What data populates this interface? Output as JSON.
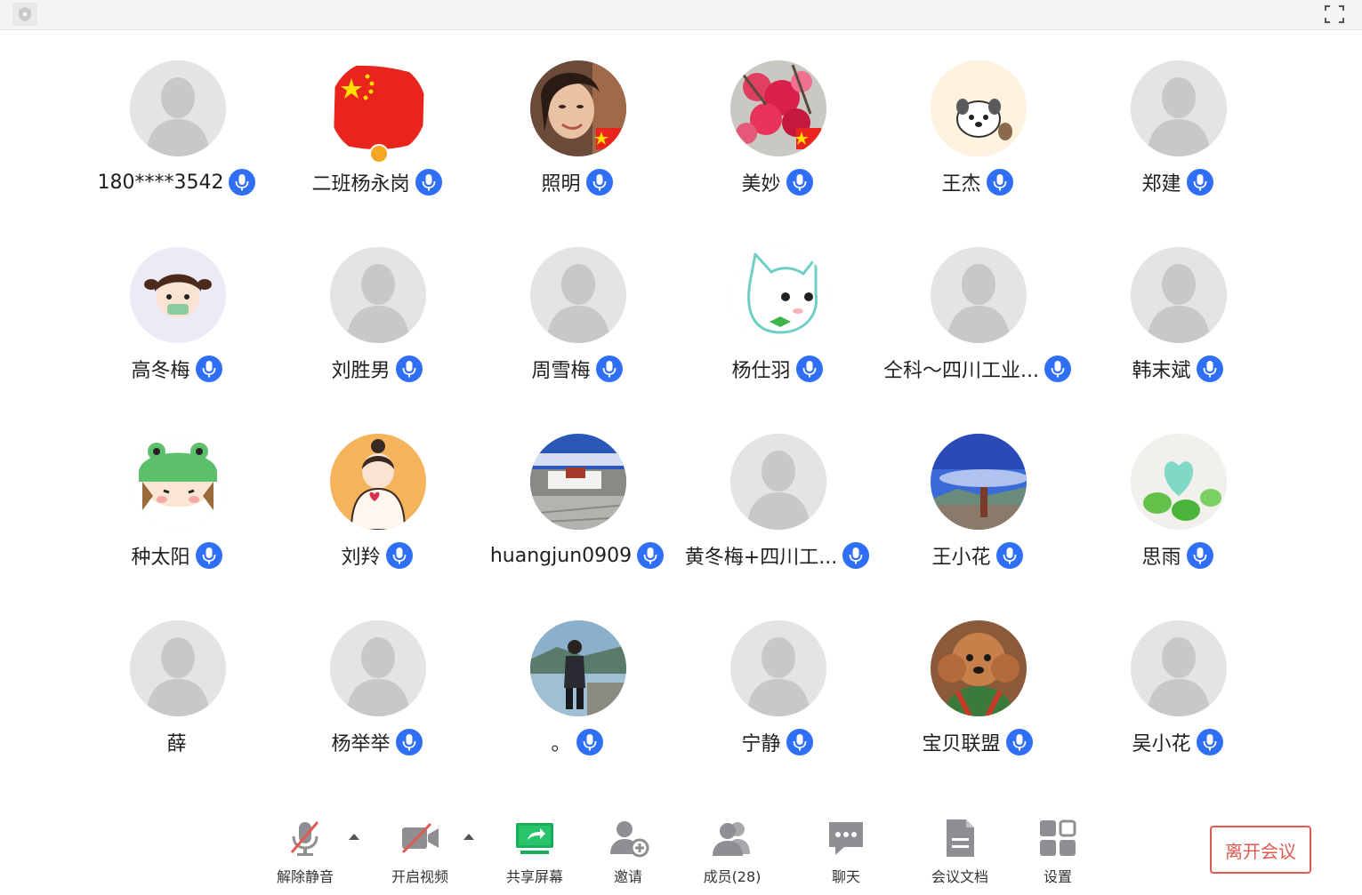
{
  "colors": {
    "mic_blue": "#2f6ff5",
    "leave_red": "#e05a52",
    "share_green": "#1aad5a",
    "placeholder_gray": "#e3e3e3"
  },
  "participants": [
    {
      "name": "180****3542",
      "avatar": "default-avatar"
    },
    {
      "name": "二班杨永岗",
      "avatar": "china-flag-avatar",
      "host_badge": true
    },
    {
      "name": "照明",
      "avatar": "woman-photo-avatar"
    },
    {
      "name": "美妙",
      "avatar": "flower-photo-avatar"
    },
    {
      "name": "王杰",
      "avatar": "cartoon-dog-avatar"
    },
    {
      "name": "郑建",
      "avatar": "default-avatar"
    },
    {
      "name": "高冬梅",
      "avatar": "cartoon-girl-avatar"
    },
    {
      "name": "刘胜男",
      "avatar": "default-avatar"
    },
    {
      "name": "周雪梅",
      "avatar": "default-avatar"
    },
    {
      "name": "杨仕羽",
      "avatar": "cartoon-cat-avatar"
    },
    {
      "name": "仝科～四川工业...",
      "avatar": "default-avatar"
    },
    {
      "name": "韩末斌",
      "avatar": "default-avatar"
    },
    {
      "name": "种太阳",
      "avatar": "cartoon-frog-girl-avatar"
    },
    {
      "name": "刘羚",
      "avatar": "cartoon-woman-avatar"
    },
    {
      "name": "huangjun0909",
      "avatar": "palace-photo-avatar"
    },
    {
      "name": "黄冬梅+四川工...",
      "avatar": "default-avatar"
    },
    {
      "name": "王小花",
      "avatar": "sky-photo-avatar"
    },
    {
      "name": "思雨",
      "avatar": "heart-photo-avatar"
    },
    {
      "name": "薛",
      "avatar": "default-avatar",
      "no_mic": true
    },
    {
      "name": "杨举举",
      "avatar": "default-avatar"
    },
    {
      "name": "。",
      "avatar": "lake-photo-avatar"
    },
    {
      "name": "宁静",
      "avatar": "default-avatar"
    },
    {
      "name": "宝贝联盟",
      "avatar": "poodle-photo-avatar"
    },
    {
      "name": "吴小花",
      "avatar": "default-avatar"
    }
  ],
  "toolbar": {
    "unmute": "解除静音",
    "start_video": "开启视频",
    "share_screen": "共享屏幕",
    "invite": "邀请",
    "members": "成员(28)",
    "chat": "聊天",
    "documents": "会议文档",
    "settings": "设置",
    "leave": "离开会议"
  }
}
